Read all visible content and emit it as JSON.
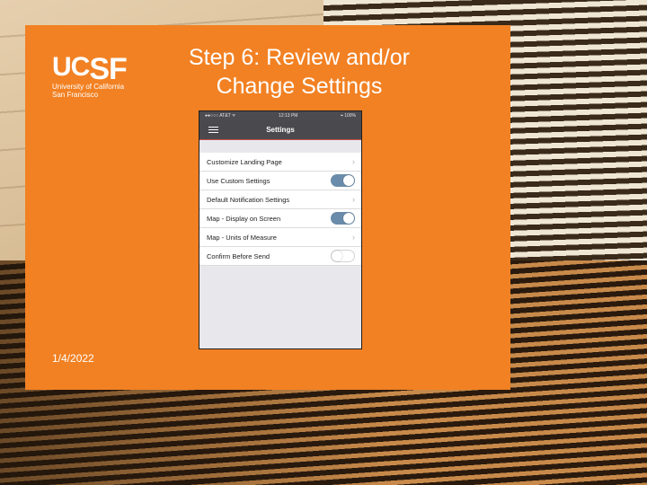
{
  "slide": {
    "title_line1": "Step 6: Review and/or",
    "title_line2": "Change Settings",
    "date": "1/4/2022",
    "logo": {
      "mark_uc": "UC",
      "mark_sf": "SF",
      "line1": "University of California",
      "line2": "San Francisco"
    }
  },
  "phone": {
    "status_left": "●●○○○ AT&T ᯤ",
    "status_time": "12:13 PM",
    "status_right": "⌖ 100%",
    "nav_title": "Settings",
    "rows": [
      {
        "label": "Customize Landing Page",
        "control": "chevron"
      },
      {
        "label": "Use Custom Settings",
        "control": "toggle",
        "state": "on"
      },
      {
        "label": "Default Notification Settings",
        "control": "chevron"
      },
      {
        "label": "Map - Display on Screen",
        "control": "toggle",
        "state": "on"
      },
      {
        "label": "Map - Units of Measure",
        "control": "chevron"
      },
      {
        "label": "Confirm Before Send",
        "control": "toggle",
        "state": "off"
      }
    ]
  },
  "colors": {
    "slide_orange": "#f28123",
    "toggle_on": "#6a8caa",
    "nav_bar": "#4a4a4e"
  },
  "icons": {
    "menu": "hamburger-icon",
    "chevron": "chevron-right-icon"
  }
}
